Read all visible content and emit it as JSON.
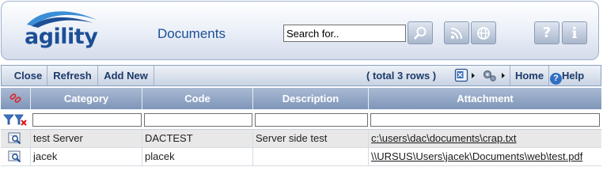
{
  "header": {
    "logo_text": "agility",
    "page_title": "Documents",
    "search": {
      "value": "Search for.."
    },
    "buttons": [
      "search-button",
      "rss-button",
      "web-button",
      "help-button",
      "info-button"
    ]
  },
  "toolbar": {
    "close": "Close",
    "refresh": "Refresh",
    "add_new": "Add New",
    "row_count": "( total 3 rows )",
    "home": "Home",
    "help": "Help"
  },
  "grid": {
    "columns": [
      "Category",
      "Code",
      "Description",
      "Attachment"
    ],
    "rows": [
      {
        "category": "test Server",
        "code": "DACTEST",
        "description": "Server side test",
        "attachment": "c:\\users\\dac\\documents\\crap.txt"
      },
      {
        "category": "jacek",
        "code": "placek",
        "description": "",
        "attachment": "\\\\URSUS\\Users\\jacek\\Documents\\web\\test.pdf"
      }
    ]
  },
  "colors": {
    "brand": "#1d4f95",
    "header_fill": "#8ea3c4",
    "toolbar_text": "#1d3a6a"
  },
  "icons": [
    "link-icon",
    "filter-icon",
    "clear-filter-icon",
    "view-record-icon",
    "export-icon",
    "settings-icon",
    "chevron-right-icon",
    "help-icon"
  ]
}
